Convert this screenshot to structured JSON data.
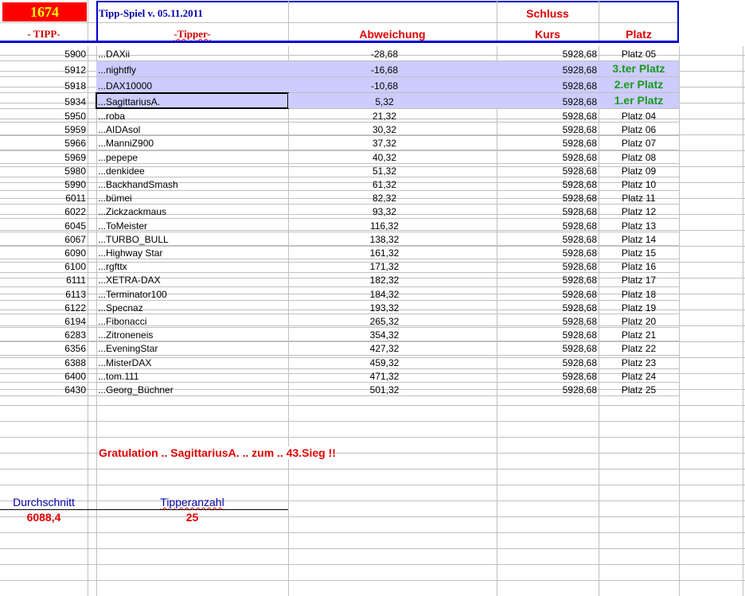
{
  "header": {
    "round_number": "1674",
    "title": "Tipp-Spiel v. 05.11.2011",
    "col_tipp": "- TIPP-",
    "col_tipper": "-Tipper-",
    "col_abweichung": "Abweichung",
    "col_schluss": "Schluss",
    "col_kurs": "Kurs",
    "col_platz": "Platz"
  },
  "rows": [
    [
      "5900",
      "...DAXii",
      "-28,68",
      "5928,68",
      "Platz 05"
    ],
    [
      "5912",
      "...nightfly",
      "-16,68",
      "5928,68",
      "3.ter Platz"
    ],
    [
      "5918",
      "...DAX10000",
      "-10,68",
      "5928,68",
      "2.er Platz"
    ],
    [
      "5934",
      "...SagittariusA.",
      "5,32",
      "5928,68",
      "1.er Platz"
    ],
    [
      "5950",
      "...roba",
      "21,32",
      "5928,68",
      "Platz 04"
    ],
    [
      "5959",
      "...AIDAsol",
      "30,32",
      "5928,68",
      "Platz 06"
    ],
    [
      "5966",
      "...ManniZ900",
      "37,32",
      "5928,68",
      "Platz 07"
    ],
    [
      "5969",
      "...pepepe",
      "40,32",
      "5928,68",
      "Platz 08"
    ],
    [
      "5980",
      "...denkidee",
      "51,32",
      "5928,68",
      "Platz 09"
    ],
    [
      "5990",
      "...BackhandSmash",
      "61,32",
      "5928,68",
      "Platz 10"
    ],
    [
      "6011",
      "...bümei",
      "82,32",
      "5928,68",
      "Platz 11"
    ],
    [
      "6022",
      "...Zickzackmaus",
      "93,32",
      "5928,68",
      "Platz 12"
    ],
    [
      "6045",
      "...ToMeister",
      "116,32",
      "5928,68",
      "Platz 13"
    ],
    [
      "6067",
      "...TURBO_BULL",
      "138,32",
      "5928,68",
      "Platz 14"
    ],
    [
      "6090",
      "...Highway Star",
      "161,32",
      "5928,68",
      "Platz 15"
    ],
    [
      "6100",
      "...rgfttx",
      "171,32",
      "5928,68",
      "Platz 16"
    ],
    [
      "6111",
      "...XETRA-DAX",
      "182,32",
      "5928,68",
      "Platz 17"
    ],
    [
      "6113",
      "...Terminator100",
      "184,32",
      "5928,68",
      "Platz 18"
    ],
    [
      "6122",
      "...Specnaz",
      "193,32",
      "5928,68",
      "Platz 19"
    ],
    [
      "6194",
      "...Fibonacci",
      "265,32",
      "5928,68",
      "Platz 20"
    ],
    [
      "6283",
      "...Zitroneneis",
      "354,32",
      "5928,68",
      "Platz 21"
    ],
    [
      "6356",
      "...EveningStar",
      "427,32",
      "5928,68",
      "Platz 22"
    ],
    [
      "6388",
      "...MisterDAX",
      "459,32",
      "5928,68",
      "Platz 23"
    ],
    [
      "6400",
      "...tom.111",
      "471,32",
      "5928,68",
      "Platz 24"
    ],
    [
      "6430",
      "...Georg_Büchner",
      "501,32",
      "5928,68",
      "Platz 25"
    ]
  ],
  "footer": {
    "gratulation": "Gratulation .. SagittariusA. .. zum .. 43.Sieg !!",
    "durchschnitt_label": "Durchschnitt",
    "durchschnitt_value": "6088,4",
    "tipperanzahl_label": "Tipperanzahl",
    "tipperanzahl_value": "25"
  },
  "colors": {
    "highlight": "#ccccff",
    "red": "#e00000",
    "green": "#1a9a1a",
    "blue": "#0000cc"
  }
}
